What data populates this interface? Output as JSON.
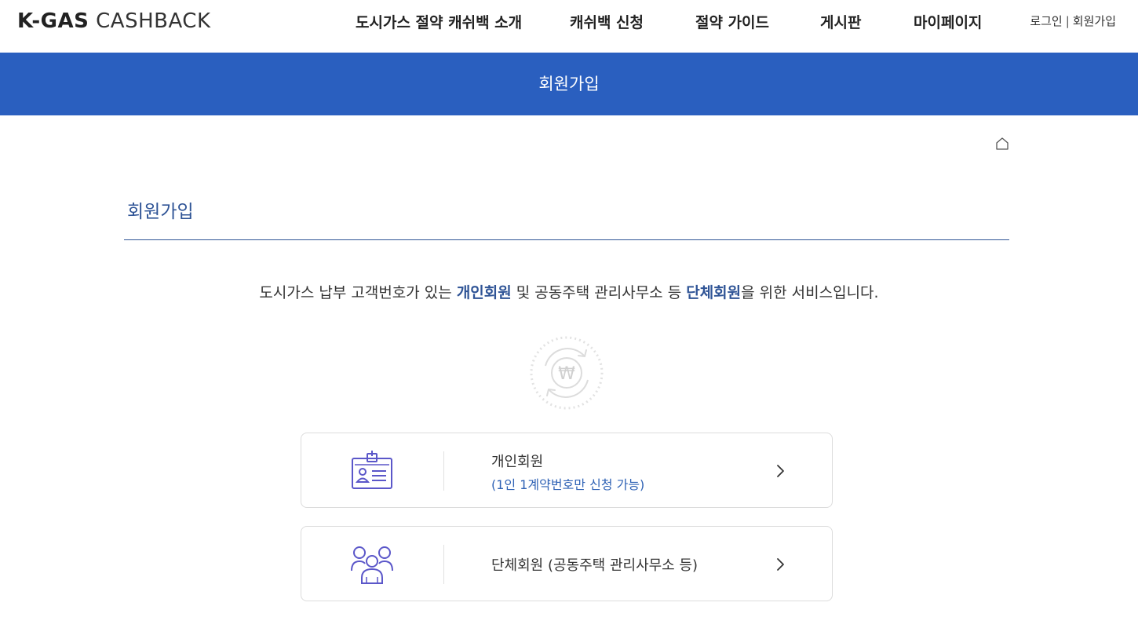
{
  "header": {
    "logo_bold": "K-GAS",
    "logo_light": "CASHBACK",
    "nav": [
      {
        "label": "도시가스 절약 캐쉬백 소개"
      },
      {
        "label": "캐쉬백 신청"
      },
      {
        "label": "절약 가이드"
      },
      {
        "label": "게시판"
      },
      {
        "label": "마이페이지"
      }
    ],
    "login": "로그인",
    "separator": "|",
    "signup": "회원가입"
  },
  "banner": {
    "title": "회원가입"
  },
  "section": {
    "title": "회원가입"
  },
  "description": {
    "part1": "도시가스 납부 고객번호가 있는 ",
    "highlight1": "개인회원",
    "part2": " 및 공동주택 관리사무소 등 ",
    "highlight2": "단체회원",
    "part3": "을 위한 서비스입니다."
  },
  "won_symbol": "₩",
  "cards": [
    {
      "label": "개인회원",
      "sub": "(1인 1계약번호만 신청 가능)",
      "icon": "id-card-icon"
    },
    {
      "label": "단체회원 (공동주택 관리사무소 등)",
      "icon": "group-icon"
    }
  ],
  "colors": {
    "banner": "#2a5fbf",
    "title": "#2f5496",
    "icon": "#5b57c9",
    "sub": "#2f62b5"
  }
}
